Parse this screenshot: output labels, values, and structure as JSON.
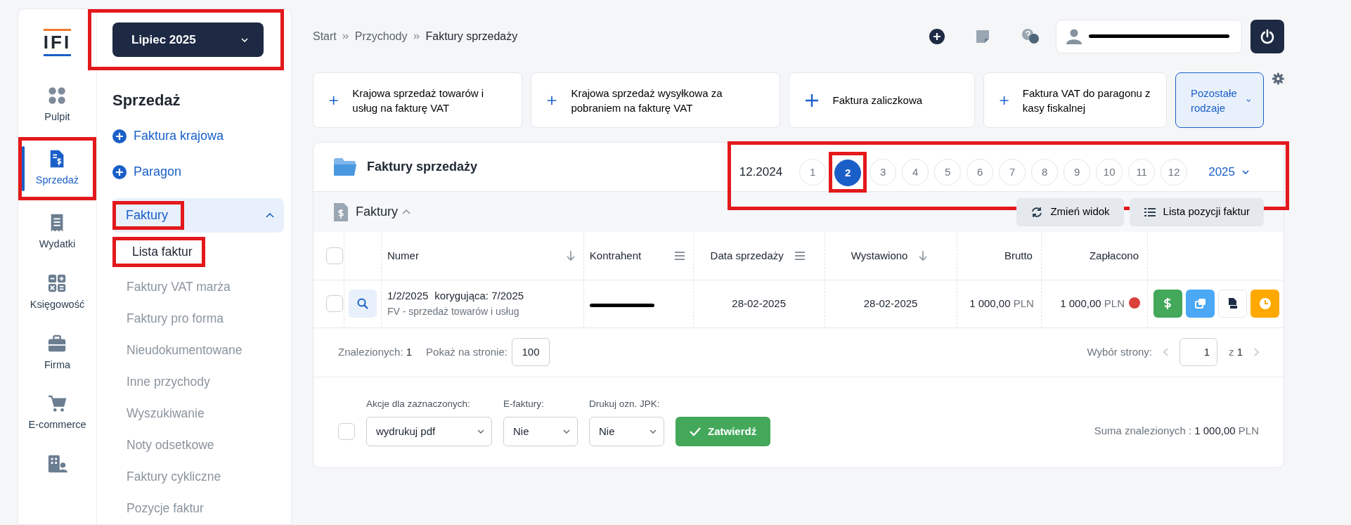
{
  "logo": {
    "text": "IFI"
  },
  "period_selector": {
    "label": "Lipiec 2025",
    "highlighted": true
  },
  "rail": [
    {
      "label": "Pulpit",
      "selected": false,
      "highlighted": false
    },
    {
      "label": "Sprzedaż",
      "selected": true,
      "highlighted": true
    },
    {
      "label": "Wydatki",
      "selected": false,
      "highlighted": false
    },
    {
      "label": "Księgowość",
      "selected": false,
      "highlighted": false
    },
    {
      "label": "Firma",
      "selected": false,
      "highlighted": false
    },
    {
      "label": "E-commerce",
      "selected": false,
      "highlighted": false
    },
    {
      "selected": false,
      "highlighted": false
    }
  ],
  "submenu": {
    "title": "Sprzedaż",
    "actions": [
      {
        "label": "Faktura krajowa"
      },
      {
        "label": "Paragon"
      }
    ],
    "group": {
      "label": "Faktury",
      "expanded": true,
      "highlighted": true,
      "children": [
        {
          "label": "Lista faktur",
          "selected": true,
          "highlighted": true
        },
        {
          "label": "Faktury VAT marża",
          "selected": false,
          "highlighted": false
        },
        {
          "label": "Faktury pro forma",
          "selected": false,
          "highlighted": false
        },
        {
          "label": "Nieudokumentowane",
          "selected": false,
          "highlighted": false
        },
        {
          "label": "Inne przychody",
          "selected": false,
          "highlighted": false
        },
        {
          "label": "Wyszukiwanie",
          "selected": false,
          "highlighted": false
        },
        {
          "label": "Noty odsetkowe",
          "selected": false,
          "highlighted": false
        },
        {
          "label": "Faktury cykliczne",
          "selected": false,
          "highlighted": false
        },
        {
          "label": "Pozycje faktur",
          "selected": false,
          "highlighted": false
        }
      ]
    }
  },
  "breadcrumb": [
    "Start",
    "Przychody",
    "Faktury sprzedaży"
  ],
  "quick_buttons": [
    {
      "label": "Krajowa sprzedaż towarów i usług na fakturę VAT"
    },
    {
      "label": "Krajowa sprzedaż wysyłkowa za pobraniem na fakturę VAT"
    },
    {
      "label": "Faktura zaliczkowa"
    },
    {
      "label": "Faktura VAT do paragonu z kasy fiskalnej"
    }
  ],
  "more_button": {
    "label": "Pozostałe rodzaje"
  },
  "card": {
    "title": "Faktury sprzedaży",
    "period_bar": {
      "highlighted": true,
      "previous": "12.2024",
      "year": "2025",
      "months": [
        {
          "label": "1",
          "selected": false,
          "highlighted": false
        },
        {
          "label": "2",
          "selected": true,
          "highlighted": true
        },
        {
          "label": "3",
          "selected": false,
          "highlighted": false
        },
        {
          "label": "4",
          "selected": false,
          "highlighted": false
        },
        {
          "label": "5",
          "selected": false,
          "highlighted": false
        },
        {
          "label": "6",
          "selected": false,
          "highlighted": false
        },
        {
          "label": "7",
          "selected": false,
          "highlighted": false
        },
        {
          "label": "8",
          "selected": false,
          "highlighted": false
        },
        {
          "label": "9",
          "selected": false,
          "highlighted": false
        },
        {
          "label": "10",
          "selected": false,
          "highlighted": false
        },
        {
          "label": "11",
          "selected": false,
          "highlighted": false
        },
        {
          "label": "12",
          "selected": false,
          "highlighted": false
        }
      ]
    },
    "section": {
      "title": "Faktury",
      "expanded": true
    },
    "toolbar": [
      {
        "label": "Zmień widok"
      },
      {
        "label": "Lista pozycji faktur"
      }
    ],
    "table": {
      "header_checked": false,
      "columns": [
        {
          "label": "Numer",
          "kind": "sort"
        },
        {
          "label": "Kontrahent",
          "kind": "filter"
        },
        {
          "label": "Data sprzedaży",
          "kind": "filter"
        },
        {
          "label": "Wystawiono",
          "kind": "sort"
        },
        {
          "label": "Brutto",
          "kind": "plain"
        },
        {
          "label": "Zapłacono",
          "kind": "plain"
        }
      ],
      "rows": [
        {
          "checked": false,
          "number": "1/2/2025",
          "correction": "korygująca: 7/2025",
          "description": "FV - sprzedaż towarów i usług",
          "sale_date": "28-02-2025",
          "issued": "28-02-2025",
          "gross": "1 000,00",
          "gross_currency": "PLN",
          "paid": "1 000,00",
          "paid_currency": "PLN",
          "color": "#d9413a"
        }
      ]
    },
    "footer": {
      "found_label": "Znalezionych:",
      "found": "1",
      "per_page_label": "Pokaż na stronie:",
      "per_page": "100",
      "page_label": "Wybór strony:",
      "page": "1",
      "of": "z",
      "pages": "1"
    },
    "bulk": {
      "checked": false,
      "selects": [
        {
          "label": "Akcje dla zaznaczonych:",
          "value": "wydrukuj pdf"
        },
        {
          "label": "E-faktury:",
          "value": "Nie"
        },
        {
          "label": "Drukuj ozn. JPK:",
          "value": "Nie"
        }
      ],
      "submit": "Zatwierdź",
      "sum_label": "Suma znalezionych :",
      "sum": "1 000,00",
      "sum_currency": "PLN"
    }
  }
}
